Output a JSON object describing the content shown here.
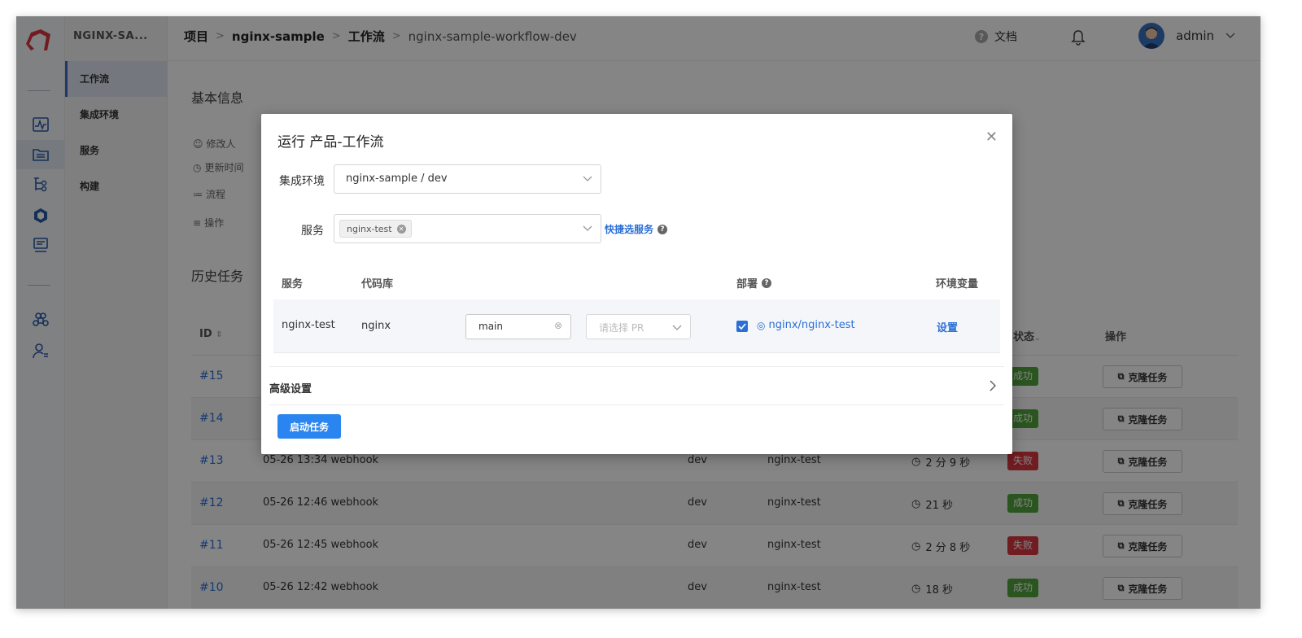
{
  "sidebar": {
    "project_short": "NGINX-SA...",
    "items": [
      {
        "label": "工作流",
        "active": true
      },
      {
        "label": "集成环境"
      },
      {
        "label": "服务"
      },
      {
        "label": "构建"
      }
    ]
  },
  "header": {
    "breadcrumb": [
      "项目",
      "nginx-sample",
      "工作流",
      "nginx-sample-workflow-dev"
    ],
    "separator": ">",
    "docs_label": "文档",
    "user_name": "admin"
  },
  "main": {
    "basic_info_title": "基本信息",
    "info_labels": [
      "修改人",
      "更新时间",
      "流程",
      "操作"
    ],
    "history_title": "历史任务",
    "table": {
      "columns": {
        "id": "ID",
        "status": "状态",
        "actions": "操作"
      },
      "clone_label": "克隆任务",
      "rows": [
        {
          "id": "#15",
          "trigger": "",
          "env": "",
          "service": "",
          "duration": "",
          "status": "成功",
          "ok": true
        },
        {
          "id": "#14",
          "trigger": "",
          "env": "",
          "service": "",
          "duration": "",
          "status": "成功",
          "ok": true
        },
        {
          "id": "#13",
          "trigger": "05-26 13:34 webhook",
          "env": "dev",
          "service": "nginx-test",
          "duration": "2 分 9 秒",
          "status": "失败",
          "ok": false
        },
        {
          "id": "#12",
          "trigger": "05-26 12:46 webhook",
          "env": "dev",
          "service": "nginx-test",
          "duration": "21 秒",
          "status": "成功",
          "ok": true
        },
        {
          "id": "#11",
          "trigger": "05-26 12:45 webhook",
          "env": "dev",
          "service": "nginx-test",
          "duration": "2 分 8 秒",
          "status": "失败",
          "ok": false
        },
        {
          "id": "#10",
          "trigger": "05-26 12:42 webhook",
          "env": "dev",
          "service": "nginx-test",
          "duration": "18 秒",
          "status": "成功",
          "ok": true
        }
      ]
    }
  },
  "modal": {
    "title": "运行 产品-工作流",
    "env_label": "集成环境",
    "env_value": "nginx-sample / dev",
    "service_label": "服务",
    "service_tag": "nginx-test",
    "quick_select": "快捷选服务",
    "columns": {
      "service": "服务",
      "repo": "代码库",
      "deploy": "部署",
      "env_vars": "环境变量"
    },
    "row": {
      "service": "nginx-test",
      "repo": "nginx",
      "branch": "main",
      "pr_placeholder": "请选择 PR",
      "deploy_target": "nginx/nginx-test",
      "settings": "设置"
    },
    "advanced": "高级设置",
    "start_button": "启动任务"
  },
  "colors": {
    "accent": "#2b85f0",
    "link": "#2b6fd6",
    "success": "#52a43a",
    "fail": "#d9363e"
  }
}
